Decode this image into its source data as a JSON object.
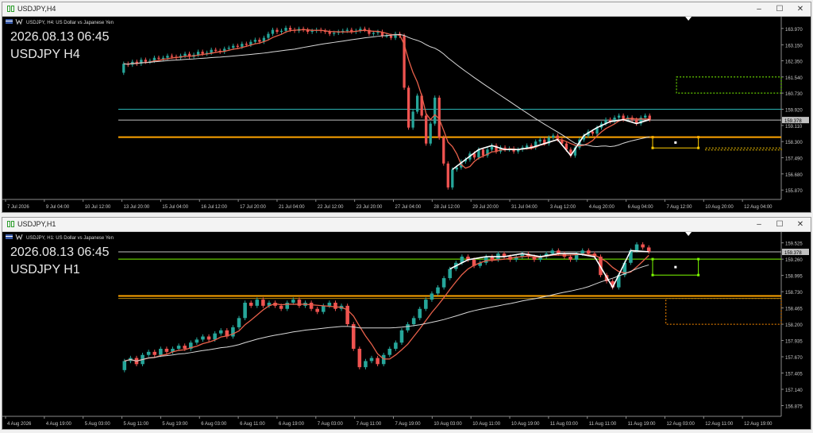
{
  "colors": {
    "background": "#000000",
    "candle_up": "#26a69a",
    "candle_down": "#ef5350",
    "fast_ma": "#e8604a",
    "slow_ma": "#d8d8d8",
    "zigzag": "#ffffff",
    "support_line": "#ffa500",
    "h4_cyan_line": "#2ab3b3",
    "h1_green_line": "#7cfc00",
    "current_price_label": "#c0c0c0"
  },
  "windows": [
    {
      "id": "h4",
      "title": "USDJPY,H4",
      "info_line": "USDJPY, H4:  US Dollar vs Japanese Yen",
      "overlay_date": "2026.08.13 06:45",
      "overlay_symbol": "USDJPY H4",
      "current_price": "159.378",
      "price_labels": [
        "163.970",
        "163.150",
        "162.350",
        "161.540",
        "160.730",
        "159.920",
        "159.110",
        "158.300",
        "157.490",
        "156.680",
        "155.870"
      ],
      "time_labels": [
        "7 Jul 2026",
        "9 Jul 04:00",
        "10 Jul 12:00",
        "13 Jul 20:00",
        "15 Jul 04:00",
        "16 Jul 12:00",
        "17 Jul 20:00",
        "21 Jul 04:00",
        "22 Jul 12:00",
        "23 Jul 20:00",
        "27 Jul 04:00",
        "28 Jul 12:00",
        "29 Jul 20:00",
        "31 Jul 04:00",
        "3 Aug 12:00",
        "4 Aug 20:00",
        "6 Aug 04:00",
        "7 Aug 12:00",
        "10 Aug 20:00",
        "12 Aug 04:00"
      ],
      "chart_data": {
        "type": "candlestick",
        "ylim": [
          155.4,
          164.4
        ],
        "closes": [
          162.2,
          162.15,
          162.3,
          162.2,
          162.4,
          162.3,
          162.35,
          162.5,
          162.45,
          162.5,
          162.6,
          162.55,
          162.5,
          162.6,
          162.7,
          162.55,
          162.65,
          162.8,
          162.7,
          162.75,
          162.9,
          162.85,
          162.8,
          162.95,
          163.0,
          163.1,
          163.05,
          163.2,
          163.15,
          163.3,
          163.4,
          163.3,
          163.5,
          163.7,
          163.9,
          163.8,
          163.85,
          164.0,
          163.9,
          163.85,
          163.95,
          163.9,
          163.8,
          163.85,
          163.9,
          163.85,
          163.8,
          163.7,
          163.75,
          163.8,
          163.85,
          163.9,
          163.8,
          163.85,
          163.95,
          163.9,
          163.7,
          163.75,
          163.8,
          163.6,
          163.6,
          163.5,
          163.7,
          163.6,
          161.0,
          159.0,
          159.8,
          160.6,
          159.6,
          158.2,
          159.2,
          160.5,
          158.5,
          157.2,
          156.0,
          156.9,
          157.0,
          157.3,
          157.4,
          157.7,
          157.5,
          157.9,
          157.6,
          157.9,
          158.1,
          157.8,
          158.0,
          157.9,
          157.95,
          157.8,
          157.9,
          158.0,
          158.1,
          158.0,
          158.3,
          158.4,
          158.2,
          158.5,
          158.6,
          158.4,
          158.2,
          157.9,
          157.6,
          158.0,
          158.4,
          158.6,
          158.8,
          158.7,
          159.0,
          159.2,
          159.4,
          159.3,
          159.5,
          159.6,
          159.4,
          159.5,
          159.4,
          159.2,
          159.5,
          159.6,
          159.4
        ],
        "current_price": 159.378,
        "horizontal_lines": [
          {
            "price": 158.52,
            "color": "#ffa500"
          },
          {
            "price": 159.92,
            "color": "#2ab3b3"
          },
          {
            "price": 159.378,
            "color": "#c0c0c0"
          }
        ],
        "boxes": [
          {
            "x0": 0.842,
            "x1": 1.0,
            "y0": 161.54,
            "y1": 160.73,
            "color": "#7cfc00",
            "style": "dotted"
          },
          {
            "x0": 0.806,
            "x1": 0.875,
            "y0": 158.52,
            "y1": 157.98,
            "color": "#ffcc00",
            "style": "solid"
          },
          {
            "x0": 0.886,
            "x1": 1.0,
            "y0": 157.98,
            "y1": 157.88,
            "color": "#ffcc00",
            "style": "dotted"
          }
        ]
      }
    },
    {
      "id": "h1",
      "title": "USDJPY,H1",
      "info_line": "USDJPY, H1:  US Dollar vs Japanese Yen",
      "overlay_date": "2026.08.13 06:45",
      "overlay_symbol": "USDJPY H1",
      "current_price": "159.378",
      "price_labels": [
        "159.525",
        "159.260",
        "158.995",
        "158.730",
        "158.465",
        "158.200",
        "157.935",
        "157.670",
        "157.405",
        "157.140",
        "156.875"
      ],
      "time_labels": [
        "4 Aug 2026",
        "4 Aug 19:00",
        "5 Aug 03:00",
        "5 Aug 11:00",
        "5 Aug 19:00",
        "6 Aug 03:00",
        "6 Aug 11:00",
        "6 Aug 19:00",
        "7 Aug 03:00",
        "7 Aug 11:00",
        "7 Aug 19:00",
        "10 Aug 03:00",
        "10 Aug 11:00",
        "10 Aug 19:00",
        "11 Aug 03:00",
        "11 Aug 11:00",
        "11 Aug 19:00",
        "12 Aug 03:00",
        "12 Aug 11:00",
        "12 Aug 19:00"
      ],
      "chart_data": {
        "type": "candlestick",
        "ylim": [
          156.7,
          159.65
        ],
        "closes": [
          157.6,
          157.65,
          157.55,
          157.7,
          157.75,
          157.7,
          157.8,
          157.75,
          157.8,
          157.85,
          157.8,
          157.9,
          157.95,
          158.0,
          157.95,
          158.05,
          158.1,
          158.0,
          158.15,
          158.3,
          158.55,
          158.5,
          158.6,
          158.5,
          158.55,
          158.5,
          158.45,
          158.55,
          158.6,
          158.5,
          158.55,
          158.45,
          158.4,
          158.5,
          158.55,
          158.45,
          158.5,
          158.2,
          157.8,
          157.5,
          157.6,
          157.65,
          157.55,
          157.7,
          157.8,
          157.9,
          158.1,
          158.2,
          158.3,
          158.45,
          158.6,
          158.7,
          158.8,
          158.95,
          159.1,
          159.2,
          159.3,
          159.25,
          159.15,
          159.2,
          159.3,
          159.25,
          159.35,
          159.3,
          159.25,
          159.3,
          159.35,
          159.3,
          159.25,
          159.3,
          159.35,
          159.4,
          159.35,
          159.3,
          159.25,
          159.35,
          159.4,
          159.35,
          159.3,
          159.0,
          158.9,
          158.8,
          159.0,
          159.2,
          159.4,
          159.5,
          159.45,
          159.38
        ],
        "current_price": 159.378,
        "horizontal_lines": [
          {
            "price": 159.26,
            "color": "#7cfc00"
          },
          {
            "price": 158.66,
            "color": "#ffa500"
          },
          {
            "price": 158.62,
            "color": "#b8860b"
          },
          {
            "price": 159.378,
            "color": "#c0c0c0"
          }
        ],
        "boxes": [
          {
            "x0": 0.806,
            "x1": 0.875,
            "y0": 159.26,
            "y1": 159.0,
            "color": "#7cfc00",
            "style": "solid"
          },
          {
            "x0": 0.826,
            "x1": 1.0,
            "y0": 158.62,
            "y1": 158.2,
            "color": "#ff8c00",
            "style": "dotted"
          }
        ]
      }
    }
  ]
}
